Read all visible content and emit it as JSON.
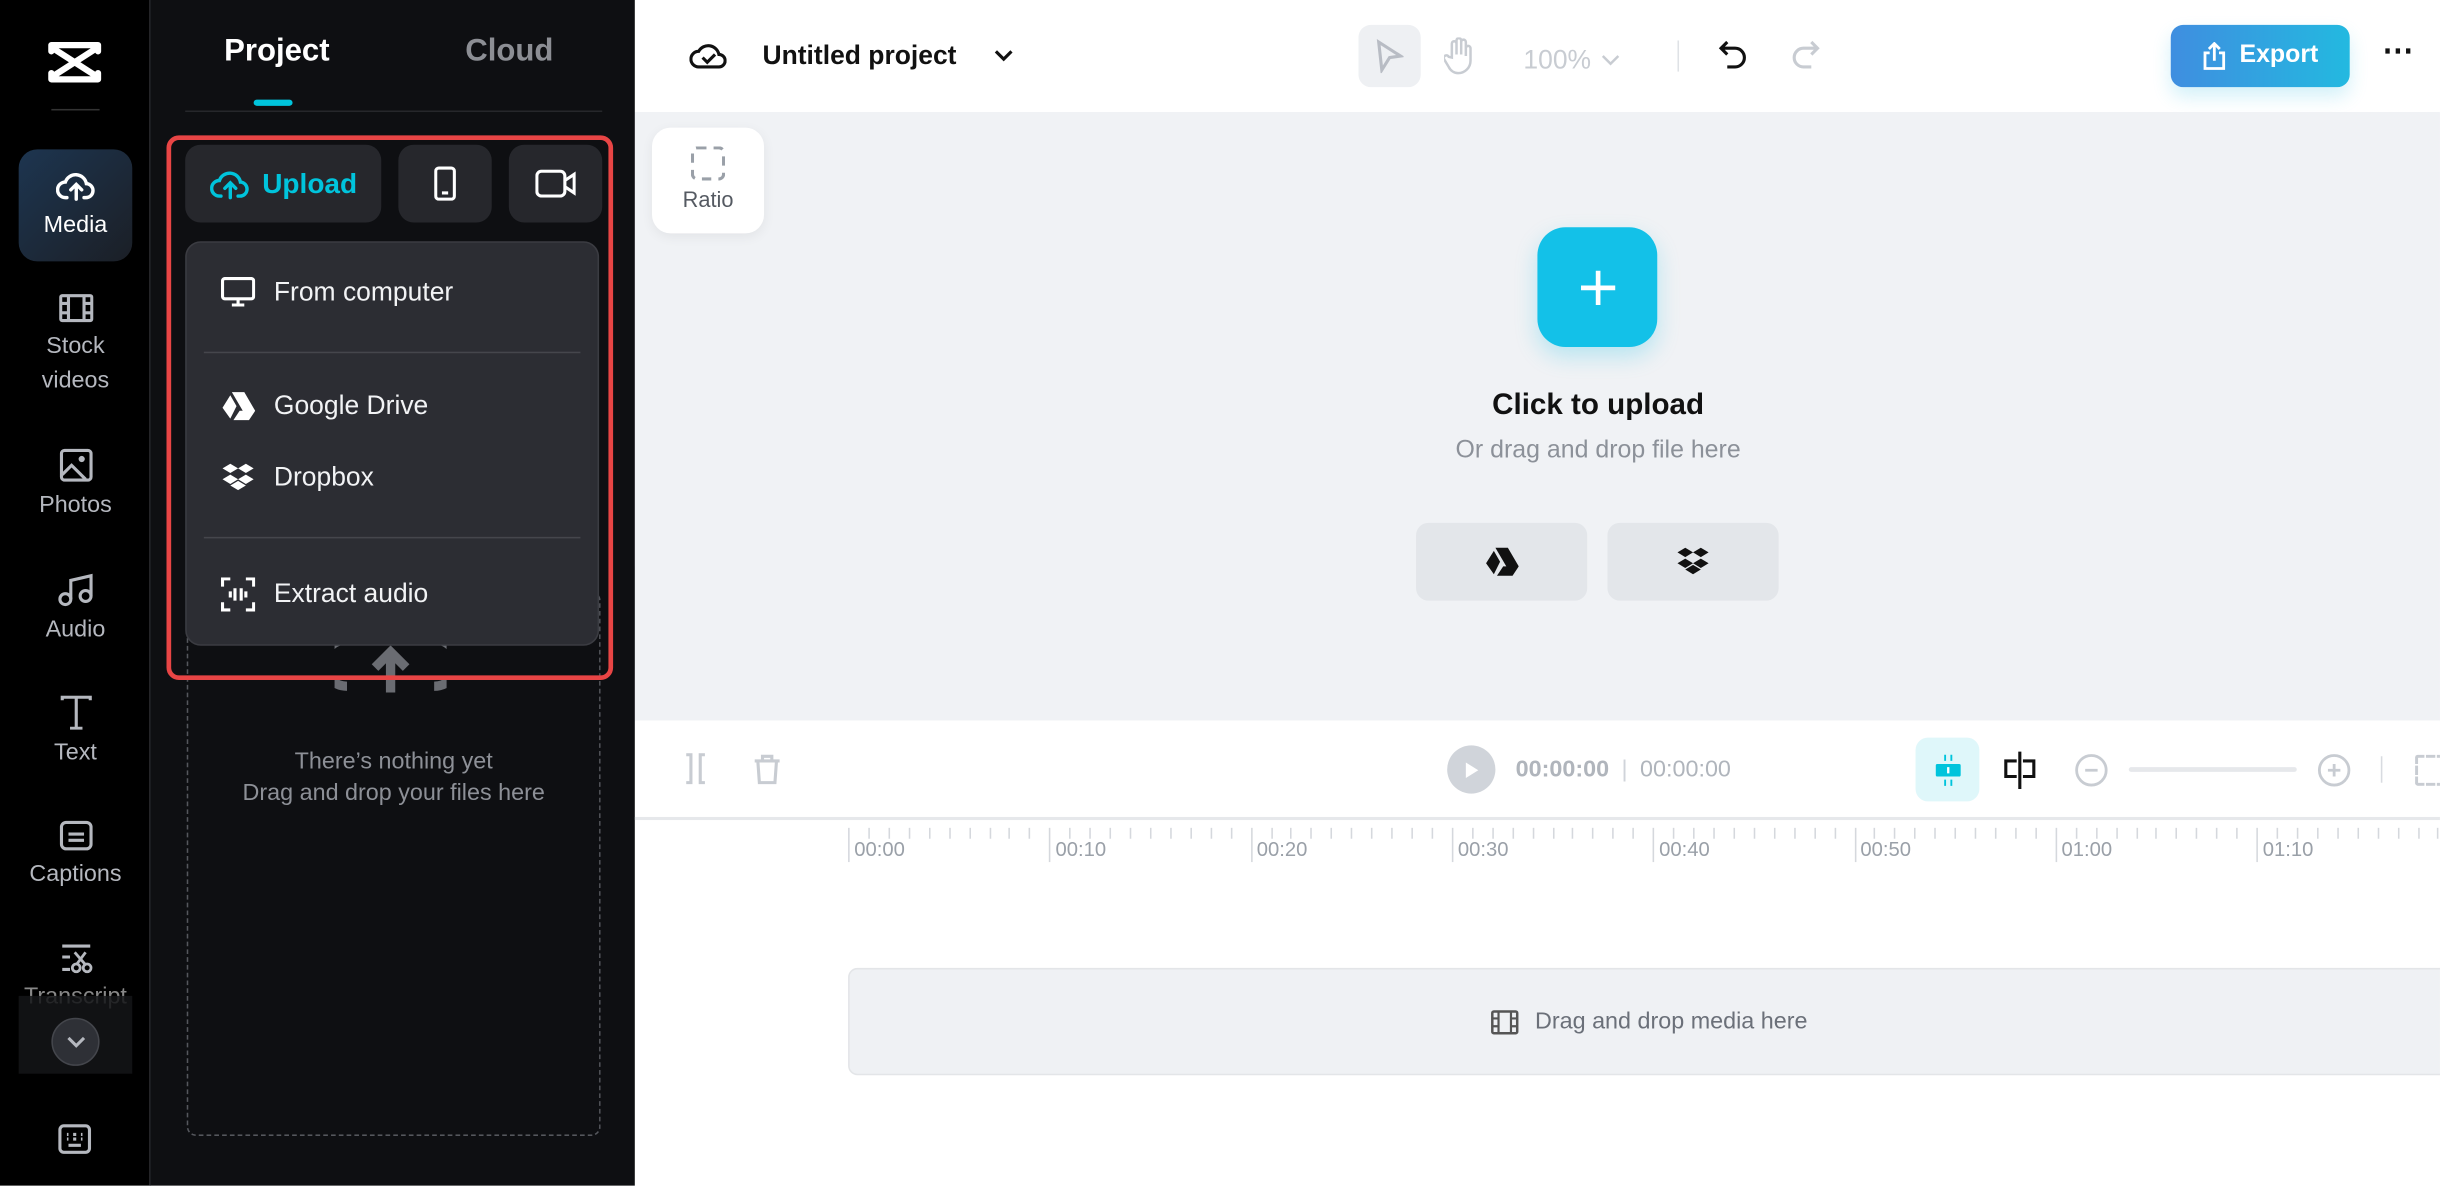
{
  "rail": {
    "items": [
      {
        "label": "Media",
        "icon": "cloud-upload-icon",
        "active": true
      },
      {
        "label": "Stock videos",
        "icon": "film-icon"
      },
      {
        "label": "Photos",
        "icon": "image-icon"
      },
      {
        "label": "Audio",
        "icon": "music-note-icon"
      },
      {
        "label": "Text",
        "icon": "text-icon"
      },
      {
        "label": "Captions",
        "icon": "captions-icon"
      },
      {
        "label": "Transcript",
        "icon": "transcript-scissors-icon"
      }
    ]
  },
  "panel": {
    "tabs": [
      {
        "label": "Project",
        "active": true
      },
      {
        "label": "Cloud"
      }
    ],
    "upload_label": "Upload",
    "menu": [
      {
        "label": "From computer",
        "icon": "monitor-icon"
      },
      {
        "label": "Google Drive",
        "icon": "google-drive-icon"
      },
      {
        "label": "Dropbox",
        "icon": "dropbox-icon"
      },
      {
        "label": "Extract audio",
        "icon": "extract-audio-icon"
      }
    ],
    "empty_line1": "There’s nothing yet",
    "empty_line2": "Drag and drop your files here"
  },
  "topbar": {
    "title": "Untitled project",
    "zoom": "100%",
    "export_label": "Export"
  },
  "canvas": {
    "ratio_label": "Ratio",
    "upload_title": "Click to upload",
    "upload_sub": "Or drag and drop file here"
  },
  "timeline": {
    "current_time": "00:00:00",
    "total_time": "00:00:00",
    "ruler": [
      "00:00",
      "00:10",
      "00:20",
      "00:30",
      "00:40",
      "00:50",
      "01:00",
      "01:10"
    ],
    "track_hint": "Drag and drop media here"
  },
  "colors": {
    "accent": "#00c4dc",
    "highlight": "#e84545",
    "export_start": "#3f8ee0",
    "export_end": "#23b9e0"
  }
}
